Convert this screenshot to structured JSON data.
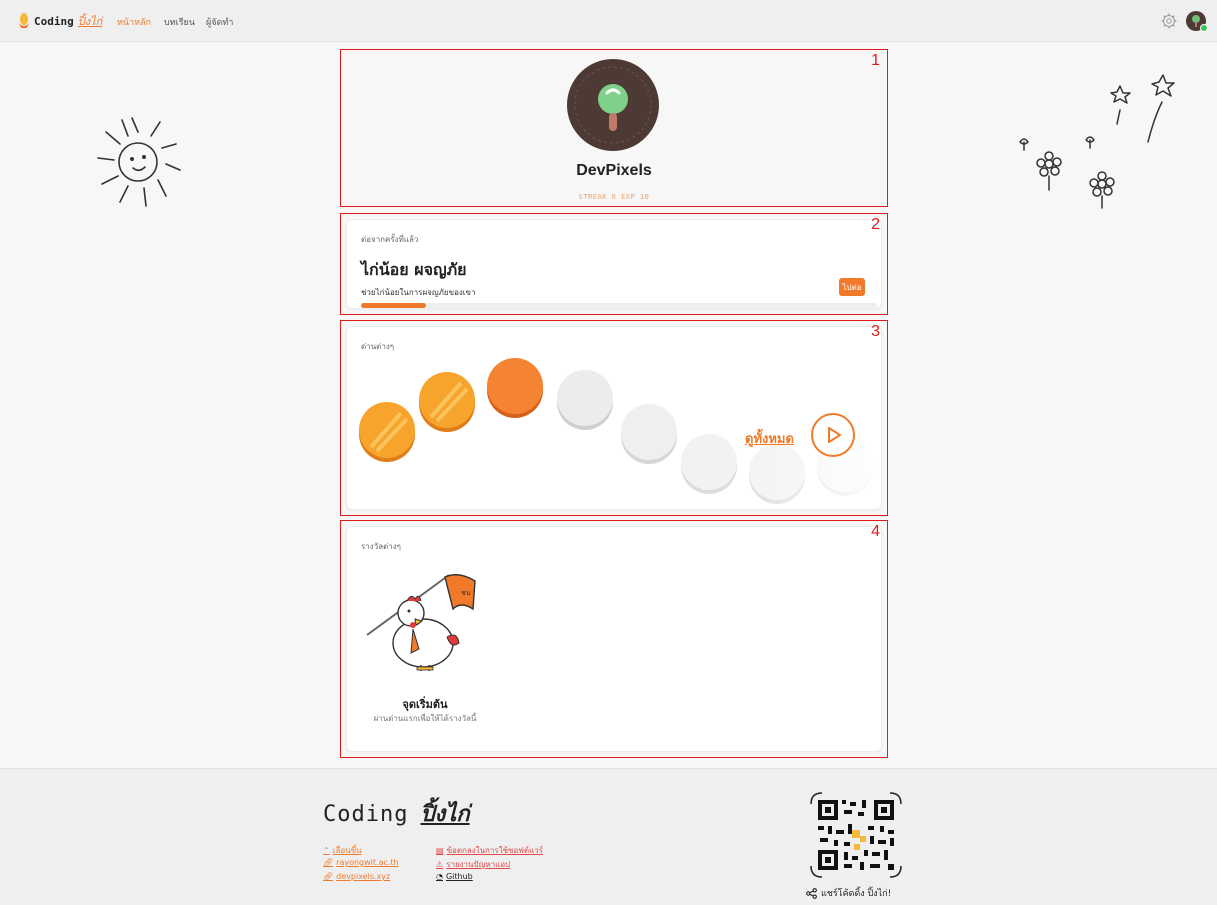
{
  "nav": {
    "brand_main": "Coding",
    "brand_sub": "ปิ้งไก่",
    "links": [
      "หน้าหลัก",
      "บทเรียน",
      "ผู้จัดทำ"
    ]
  },
  "profile": {
    "username": "DevPixels",
    "stats": "STREAK 0 EXP 10"
  },
  "section_numbers": [
    "1",
    "2",
    "3",
    "4"
  ],
  "continue": {
    "label": "ต่อจากครั้งที่แล้ว",
    "title": "ไก่น้อย ผจญภัย",
    "description": "ช่วยไก่น้อยในการผจญภัยของเขา",
    "button": "ไปต่อ",
    "progress": 0.125
  },
  "levels": {
    "label": "ด่านต่างๆ",
    "view_all": "ดูทั้งหมด"
  },
  "rewards": {
    "label": "รางวัลต่างๆ",
    "items": [
      {
        "title": "จุดเริ่มต้น",
        "description": "ผ่านด่านแรกเพื่อให้ได้รางวัลนี้"
      }
    ]
  },
  "footer": {
    "brand_main": "Coding",
    "brand_sub": "ปิ้งไก่",
    "links_left": [
      "เลื่อนขึ้น",
      "rayongwit.ac.th",
      "devpixels.xyz"
    ],
    "links_right": [
      "ข้อตกลงในการใช้ซอฟต์แวร์",
      "รายงานปัญหาแอป",
      "Github"
    ],
    "share": "แชร์โค้ดดิ้ง ปิ้งไก่!"
  },
  "colors": {
    "accent": "#f07a2a",
    "frame": "#e01b1b",
    "avatar_bg": "#4d3a34"
  }
}
